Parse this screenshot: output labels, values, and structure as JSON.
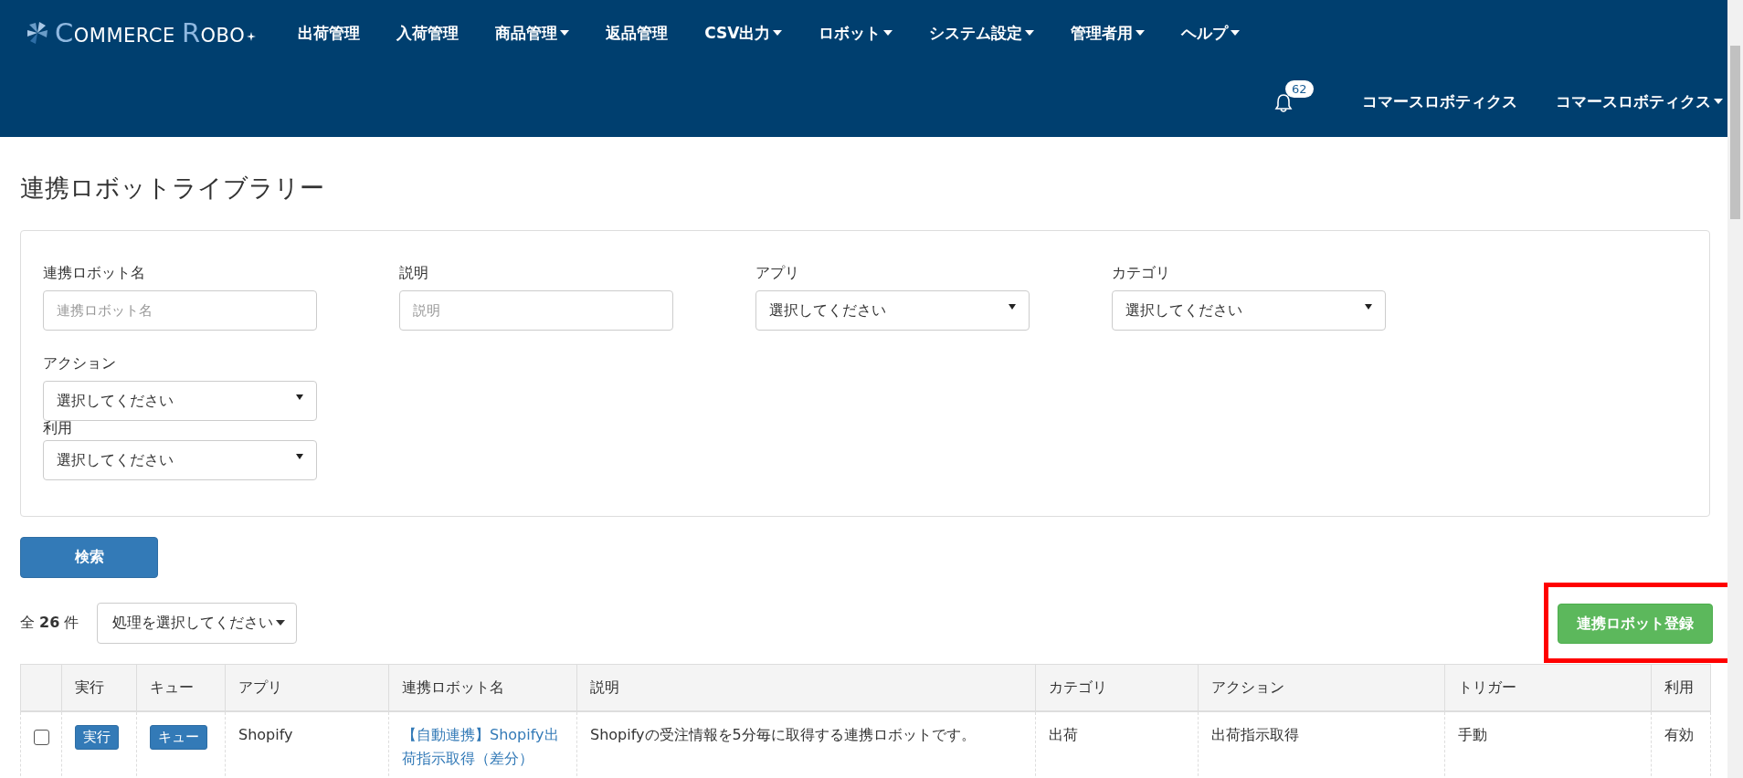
{
  "brand": {
    "first_letter": "C",
    "first_rest": "OMMERCE",
    "second_letter": "R",
    "second_rest": "OBO"
  },
  "nav": [
    {
      "label": "出荷管理",
      "dropdown": false
    },
    {
      "label": "入荷管理",
      "dropdown": false
    },
    {
      "label": "商品管理",
      "dropdown": true
    },
    {
      "label": "返品管理",
      "dropdown": false
    },
    {
      "label": "CSV出力",
      "dropdown": true
    },
    {
      "label": "ロボット",
      "dropdown": true
    },
    {
      "label": "システム設定",
      "dropdown": true
    },
    {
      "label": "管理者用",
      "dropdown": true
    },
    {
      "label": "ヘルプ",
      "dropdown": true
    }
  ],
  "notifications": {
    "count": "62"
  },
  "user_links": [
    {
      "label": "コマースロボティクス",
      "dropdown": false
    },
    {
      "label": "コマースロボティクス",
      "dropdown": true
    }
  ],
  "page_title": "連携ロボットライブラリー",
  "filters": [
    {
      "label": "連携ロボット名",
      "kind": "text",
      "placeholder": "連携ロボット名"
    },
    {
      "label": "説明",
      "kind": "text",
      "placeholder": "説明"
    },
    {
      "label": "アプリ",
      "kind": "select",
      "value": "選択してください"
    },
    {
      "label": "カテゴリ",
      "kind": "select",
      "value": "選択してください"
    },
    {
      "label": "アクション",
      "kind": "select",
      "value": "選択してください"
    },
    {
      "label": "利用",
      "kind": "select",
      "value": "選択してください"
    }
  ],
  "search_button": "検索",
  "count": {
    "prefix": "全",
    "number": "26",
    "suffix": "件"
  },
  "bulk_action": "処理を選択してください",
  "register_button": {
    "label": "連携ロボット登録",
    "highlighted": true
  },
  "table": {
    "columns": [
      "",
      "実行",
      "キュー",
      "アプリ",
      "連携ロボット名",
      "説明",
      "カテゴリ",
      "アクション",
      "トリガー",
      "利用"
    ],
    "rows": [
      {
        "checked": false,
        "run": "実行",
        "queue": "キュー",
        "app": "Shopify",
        "name": "【自動連携】Shopify出荷指示取得（差分）",
        "description": "Shopifyの受注情報を5分毎に取得する連携ロボットです。",
        "category": "出荷",
        "action": "出荷指示取得",
        "trigger": "手動",
        "status": "有効"
      }
    ]
  }
}
